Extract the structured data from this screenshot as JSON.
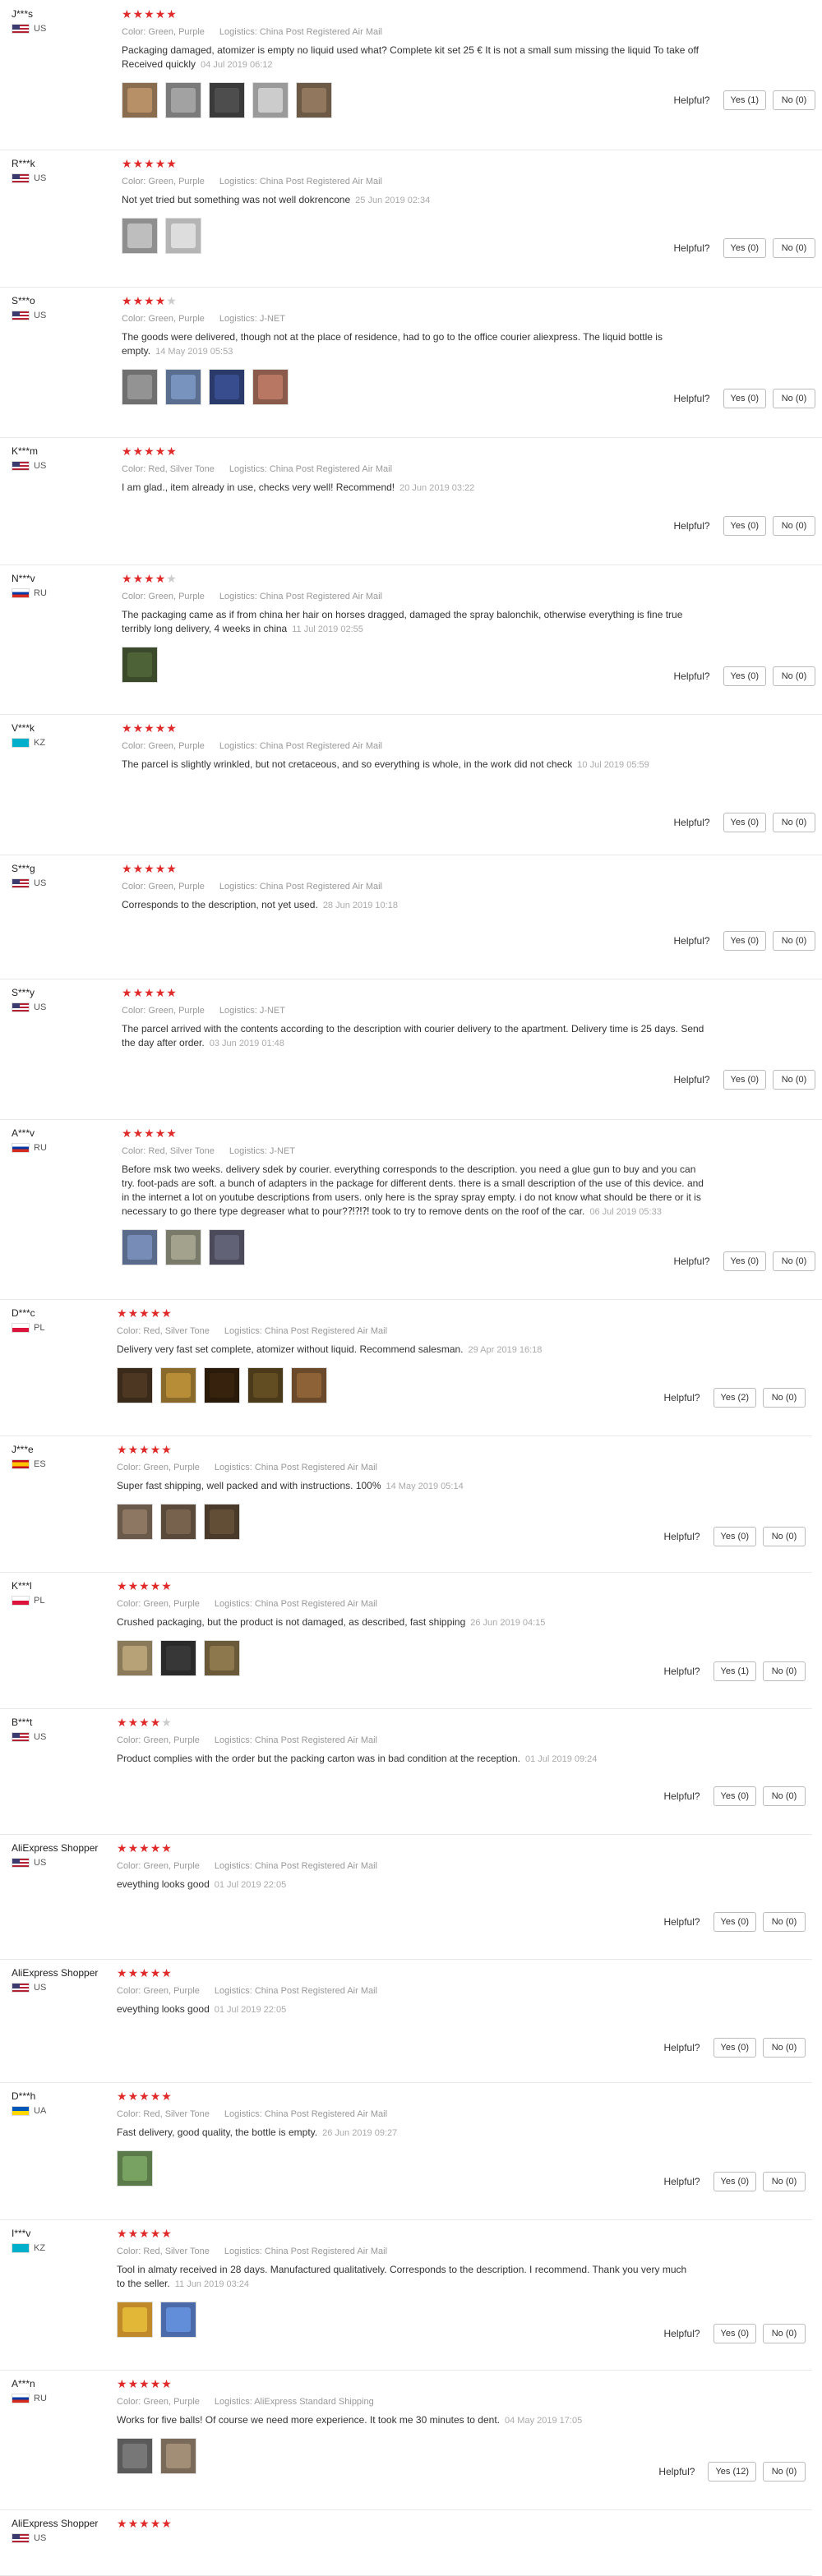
{
  "labels": {
    "color": "Color:",
    "logistics": "Logistics:",
    "helpful": "Helpful?"
  },
  "reviews": [
    {
      "user": "J***s",
      "country": "US",
      "stars": 5,
      "color": "Green, Purple",
      "logistics": "China Post Registered Air Mail",
      "text": "Packaging damaged, atomizer is empty no liquid used what? Complete kit set 25 € It is not a small sum missing the liquid To take off Received quickly",
      "date": "04 Jul 2019 06:12",
      "photos": [
        "#8a6d4e",
        "#7a7a7a",
        "#3a3a3a",
        "#9a9a9a",
        "#6d5a46"
      ],
      "yes": "Yes (1)",
      "no": "No (0)"
    },
    {
      "user": "R***k",
      "country": "US",
      "stars": 5,
      "color": "Green, Purple",
      "logistics": "China Post Registered Air Mail",
      "text": "Not yet tried but something was not well dokrencone",
      "date": "25 Jun 2019 02:34",
      "photos": [
        "#8f8f8f",
        "#b5b5b5"
      ],
      "yes": "Yes (0)",
      "no": "No (0)"
    },
    {
      "user": "S***o",
      "country": "US",
      "stars": 4,
      "color": "Green, Purple",
      "logistics": "J-NET",
      "text": "The goods were delivered, though not at the place of residence, had to go to the office courier aliexpress. The liquid bottle is empty.",
      "date": "14 May 2019 05:53",
      "photos": [
        "#6f6f6f",
        "#5a6f8f",
        "#2a3a6a",
        "#8a5a4a"
      ],
      "yes": "Yes (0)",
      "no": "No (0)"
    },
    {
      "user": "K***m",
      "country": "US",
      "stars": 5,
      "color": "Red, Silver Tone",
      "logistics": "China Post Registered Air Mail",
      "text": "I am glad., item already in use, checks very well! Recommend!",
      "date": "20 Jun 2019 03:22",
      "photos": [],
      "yes": "Yes (0)",
      "no": "No (0)"
    },
    {
      "user": "N***v",
      "country": "RU",
      "stars": 4,
      "color": "Green, Purple",
      "logistics": "China Post Registered Air Mail",
      "text": "The packaging came as if from china her hair on horses dragged, damaged the spray balonchik, otherwise everything is fine true terribly long delivery, 4 weeks in china",
      "date": "11 Jul 2019 02:55",
      "photos": [
        "#3a4a2a"
      ],
      "yes": "Yes (0)",
      "no": "No (0)"
    },
    {
      "user": "V***k",
      "country": "KZ",
      "stars": 5,
      "color": "Green, Purple",
      "logistics": "China Post Registered Air Mail",
      "text": "The parcel is slightly wrinkled, but not cretaceous, and so everything is whole, in the work did not check",
      "date": "10 Jul 2019 05:59",
      "photos": [],
      "yes": "Yes (0)",
      "no": "No (0)"
    },
    {
      "user": "S***g",
      "country": "US",
      "stars": 5,
      "color": "Green, Purple",
      "logistics": "China Post Registered Air Mail",
      "text": "Corresponds to the description, not yet used.",
      "date": "28 Jun 2019 10:18",
      "photos": [],
      "yes": "Yes (0)",
      "no": "No (0)"
    },
    {
      "user": "S***y",
      "country": "US",
      "stars": 5,
      "color": "Green, Purple",
      "logistics": "J-NET",
      "text": "The parcel arrived with the contents according to the description with courier delivery to the apartment. Delivery time is 25 days. Send the day after order.",
      "date": "03 Jun 2019 01:48",
      "photos": [],
      "yes": "Yes (0)",
      "no": "No (0)"
    },
    {
      "user": "A***v",
      "country": "RU",
      "stars": 5,
      "color": "Red, Silver Tone",
      "logistics": "J-NET",
      "text": "Before msk two weeks. delivery sdek by courier. everything corresponds to the description. you need a glue gun to buy and you can try. foot-pads are soft. a bunch of adapters in the package for different dents. there is a small description of the use of this device. and in the internet a lot on youtube descriptions from users. only here is the spray spray empty. i do not know what should be there or it is necessary to go there type degreaser what to pour?⁈⁈⁈ took to try to remove dents on the roof of the car.",
      "date": "06 Jul 2019 05:33",
      "photos": [
        "#5a6a8a",
        "#7a7a6a",
        "#4a4a5a"
      ],
      "yes": "Yes (0)",
      "no": "No (0)"
    },
    {
      "user": "D***c",
      "country": "PL",
      "stars": 5,
      "color": "Red, Silver Tone",
      "logistics": "China Post Registered Air Mail",
      "text": "Delivery very fast set complete, atomizer without liquid. Recommend salesman.",
      "date": "29 Apr 2019 16:18",
      "photos": [
        "#3a2a1a",
        "#8a6a2a",
        "#2a1a0a",
        "#4a3a1a",
        "#6a4a2a"
      ],
      "yes": "Yes (2)",
      "no": "No (0)"
    },
    {
      "user": "J***e",
      "country": "ES",
      "stars": 5,
      "color": "Green, Purple",
      "logistics": "China Post Registered Air Mail",
      "text": "Super fast shipping, well packed and with instructions. 100%",
      "date": "14 May 2019 05:14",
      "photos": [
        "#6a5a4a",
        "#5a4a3a",
        "#4a3a2a"
      ],
      "yes": "Yes (0)",
      "no": "No (0)"
    },
    {
      "user": "K***l",
      "country": "PL",
      "stars": 5,
      "color": "Green, Purple",
      "logistics": "China Post Registered Air Mail",
      "text": "Crushed packaging, but the product is not damaged, as described, fast shipping",
      "date": "26 Jun 2019 04:15",
      "photos": [
        "#8a7a5a",
        "#2a2a2a",
        "#6a5a3a"
      ],
      "yes": "Yes (1)",
      "no": "No (0)"
    },
    {
      "user": "B***t",
      "country": "US",
      "stars": 4,
      "color": "Green, Purple",
      "logistics": "China Post Registered Air Mail",
      "text": "Product complies with the order but the packing carton was in bad condition at the reception.",
      "date": "01 Jul 2019 09:24",
      "photos": [],
      "yes": "Yes (0)",
      "no": "No (0)"
    },
    {
      "user": "AliExpress Shopper",
      "country": "US",
      "stars": 5,
      "color": "Green, Purple",
      "logistics": "China Post Registered Air Mail",
      "text": "eveything looks good",
      "date": "01 Jul 2019 22:05",
      "photos": [],
      "yes": "Yes (0)",
      "no": "No (0)"
    },
    {
      "user": "AliExpress Shopper",
      "country": "US",
      "stars": 5,
      "color": "Green, Purple",
      "logistics": "China Post Registered Air Mail",
      "text": "eveything looks good",
      "date": "01 Jul 2019 22:05",
      "photos": [],
      "yes": "Yes (0)",
      "no": "No (0)"
    },
    {
      "user": "D***h",
      "country": "UA",
      "stars": 5,
      "color": "Red, Silver Tone",
      "logistics": "China Post Registered Air Mail",
      "text": "Fast delivery, good quality, the bottle is empty.",
      "date": "26 Jun 2019 09:27",
      "photos": [
        "#5a7a4a"
      ],
      "yes": "Yes (0)",
      "no": "No (0)"
    },
    {
      "user": "I***v",
      "country": "KZ",
      "stars": 5,
      "color": "Red, Silver Tone",
      "logistics": "China Post Registered Air Mail",
      "text": "Tool in almaty received in 28 days. Manufactured qualitatively. Corresponds to the description. I recommend. Thank you very much to the seller.",
      "date": "11 Jun 2019 03:24",
      "photos": [
        "#c08a2a",
        "#4a6aaa"
      ],
      "yes": "Yes (0)",
      "no": "No (0)"
    },
    {
      "user": "A***n",
      "country": "RU",
      "stars": 5,
      "color": "Green, Purple",
      "logistics": "AliExpress Standard Shipping",
      "text": "Works for five balls! Of course we need more experience. It took me 30 minutes to dent.",
      "date": "04 May 2019 17:05",
      "photos": [
        "#5a5a5a",
        "#7a6a5a"
      ],
      "yes": "Yes (12)",
      "no": "No (0)"
    },
    {
      "user": "AliExpress Shopper",
      "country": "US",
      "stars": 5,
      "color": "",
      "logistics": "",
      "text": "",
      "date": "",
      "photos": [],
      "yes": "",
      "no": ""
    }
  ]
}
